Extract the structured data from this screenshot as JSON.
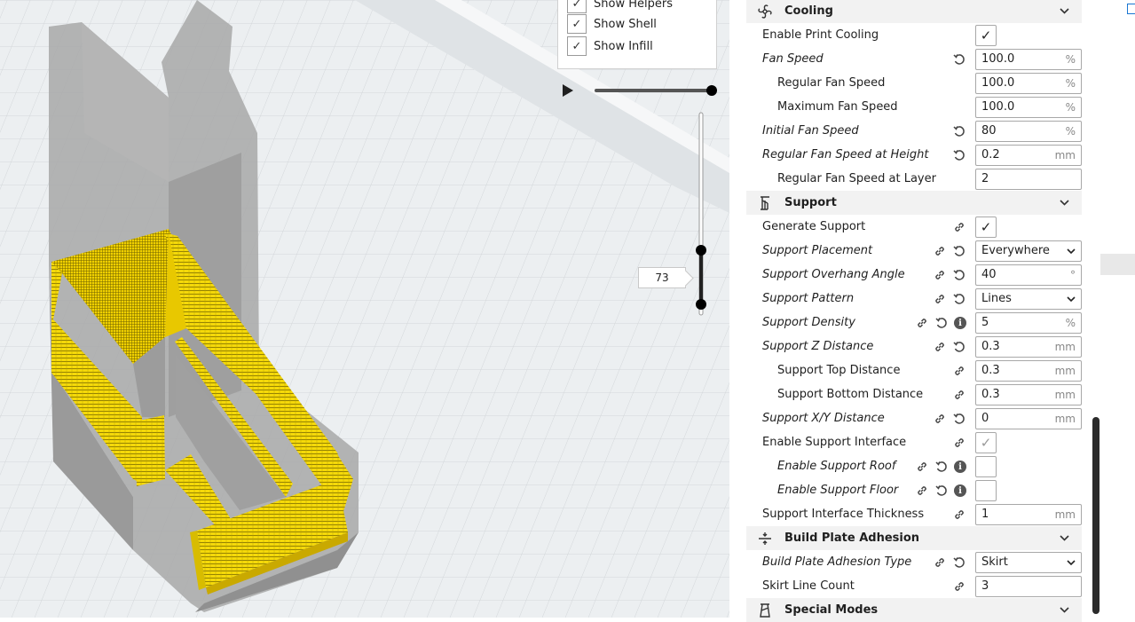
{
  "view_options": {
    "items": [
      {
        "label": "Show Helpers",
        "checked": true
      },
      {
        "label": "Show Shell",
        "checked": true
      },
      {
        "label": "Show Infill",
        "checked": true
      }
    ]
  },
  "layer_view": {
    "current_layer": "73"
  },
  "settings": {
    "cooling": {
      "title": "Cooling",
      "icon": "fan-icon",
      "enable_print_cooling": {
        "label": "Enable Print Cooling",
        "checked": true
      },
      "fan_speed": {
        "label": "Fan Speed",
        "value": "100.0",
        "unit": "%"
      },
      "regular_fan_speed": {
        "label": "Regular Fan Speed",
        "value": "100.0",
        "unit": "%"
      },
      "maximum_fan_speed": {
        "label": "Maximum Fan Speed",
        "value": "100.0",
        "unit": "%"
      },
      "initial_fan_speed": {
        "label": "Initial Fan Speed",
        "value": "80",
        "unit": "%"
      },
      "regular_fan_speed_at_height": {
        "label": "Regular Fan Speed at Height",
        "value": "0.2",
        "unit": "mm"
      },
      "regular_fan_speed_at_layer": {
        "label": "Regular Fan Speed at Layer",
        "value": "2"
      }
    },
    "support": {
      "title": "Support",
      "icon": "support-icon",
      "generate_support": {
        "label": "Generate Support",
        "checked": true
      },
      "support_placement": {
        "label": "Support Placement",
        "value": "Everywhere"
      },
      "support_overhang_angle": {
        "label": "Support Overhang Angle",
        "value": "40",
        "unit": "°"
      },
      "support_pattern": {
        "label": "Support Pattern",
        "value": "Lines"
      },
      "support_density": {
        "label": "Support Density",
        "value": "5",
        "unit": "%"
      },
      "support_z_distance": {
        "label": "Support Z Distance",
        "value": "0.3",
        "unit": "mm"
      },
      "support_top_distance": {
        "label": "Support Top Distance",
        "value": "0.3",
        "unit": "mm"
      },
      "support_bottom_distance": {
        "label": "Support Bottom Distance",
        "value": "0.3",
        "unit": "mm"
      },
      "support_xy_distance": {
        "label": "Support X/Y Distance",
        "value": "0",
        "unit": "mm"
      },
      "enable_support_interface": {
        "label": "Enable Support Interface",
        "checked": true
      },
      "enable_support_roof": {
        "label": "Enable Support Roof",
        "checked": false
      },
      "enable_support_floor": {
        "label": "Enable Support Floor",
        "checked": false
      },
      "support_interface_thickness": {
        "label": "Support Interface Thickness",
        "value": "1",
        "unit": "mm"
      }
    },
    "build_plate_adhesion": {
      "title": "Build Plate Adhesion",
      "icon": "adhesion-icon",
      "build_plate_adhesion_type": {
        "label": "Build Plate Adhesion Type",
        "value": "Skirt"
      },
      "skirt_line_count": {
        "label": "Skirt Line Count",
        "value": "3"
      }
    },
    "special_modes": {
      "title": "Special Modes",
      "icon": "special-modes-icon"
    }
  },
  "colors": {
    "model_yellow": "#f5d90a",
    "model_shell_gray": "#a8a8a8",
    "build_plate": "#eceff1",
    "accent": "#1976d2"
  }
}
